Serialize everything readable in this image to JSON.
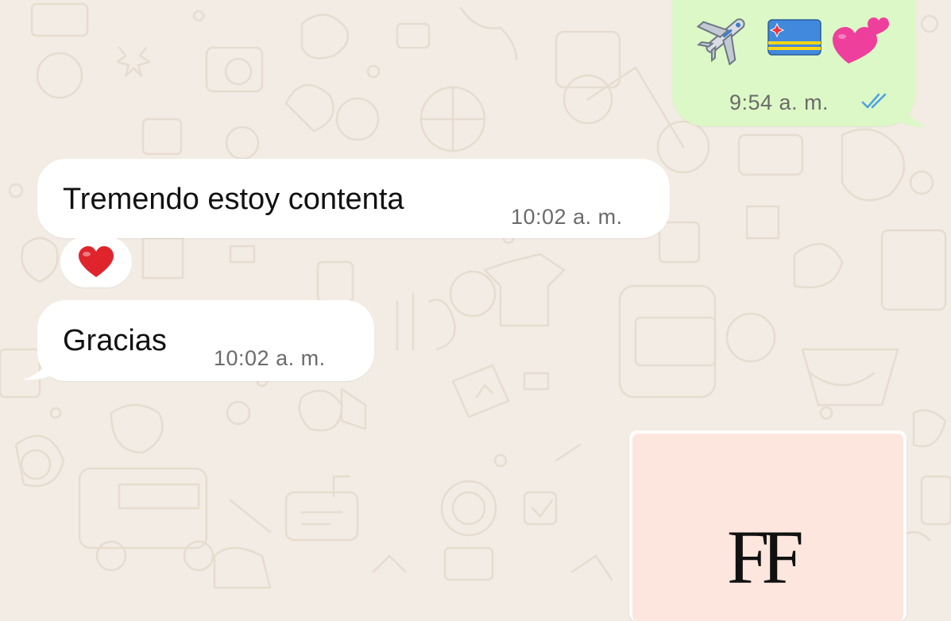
{
  "messages": [
    {
      "direction": "outgoing",
      "emojis": [
        "airplane-icon",
        "aruba-flag-icon",
        "two-hearts-icon"
      ],
      "time": "9:54 a. m.",
      "status": "read-double-check-icon"
    },
    {
      "direction": "incoming",
      "text": "Tremendo estoy contenta",
      "time": "10:02 a. m.",
      "reaction": "red-heart-icon"
    },
    {
      "direction": "incoming",
      "text": "Gracias",
      "time": "10:02 a. m."
    },
    {
      "direction": "outgoing",
      "type": "image",
      "image_logo_text": "FF"
    }
  ],
  "colors": {
    "wallpaper": "#f3ece4",
    "incoming_bubble": "#ffffff",
    "outgoing_bubble": "#dcf8c6",
    "read_ticks": "#4fa3e0",
    "timestamp": "#6b6b6b",
    "media_background": "#fde6dd"
  }
}
